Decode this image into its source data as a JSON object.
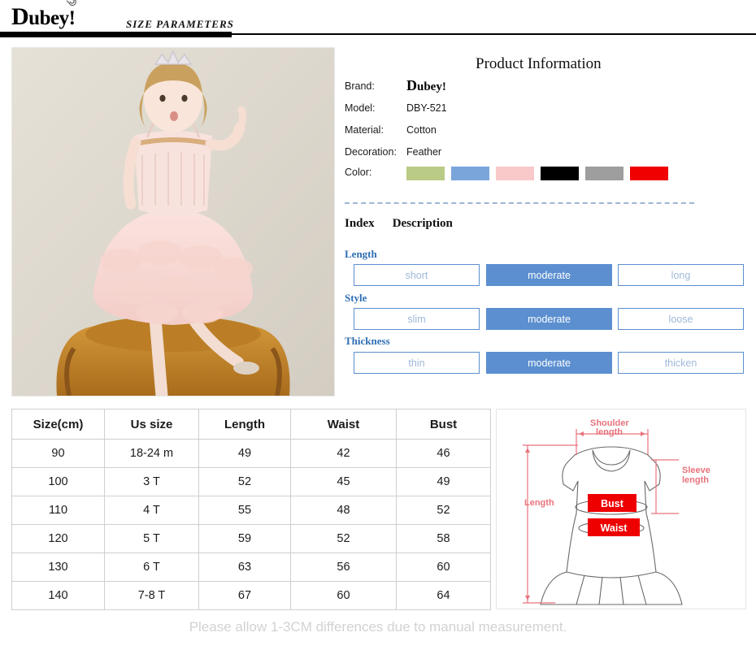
{
  "header": {
    "logo_text": "Dubey",
    "logo_initial": "D",
    "logo_rest": "ubey",
    "logo_mark": "spiral-exclamation",
    "title": "SIZE  PARAMETERS"
  },
  "photo": {
    "alt": "Girl wearing pink feather tutu dress with tiara sitting on mustard velvet armchair",
    "background_color": "#ddd8cf",
    "dress_color": "#f6d9d5",
    "chair_color": "#c98a2e",
    "hair_color": "#c9a05e"
  },
  "product_information": {
    "heading": "Product  Information",
    "rows": [
      {
        "label": "Brand:",
        "value": "Dubey",
        "is_logo": true
      },
      {
        "label": "Model:",
        "value": "DBY-521",
        "is_logo": false
      },
      {
        "label": "Material:",
        "value": "Cotton",
        "is_logo": false
      },
      {
        "label": "Decoration:",
        "value": "Feather",
        "is_logo": false
      }
    ],
    "color_label": "Color:",
    "colors": [
      {
        "name": "light-green",
        "hex": "#b9cb84"
      },
      {
        "name": "blue",
        "hex": "#7aa5da"
      },
      {
        "name": "pink",
        "hex": "#f9c9c9"
      },
      {
        "name": "black",
        "hex": "#000000"
      },
      {
        "name": "gray",
        "hex": "#9e9e9e"
      },
      {
        "name": "red",
        "hex": "#f10000"
      }
    ]
  },
  "index_section": {
    "heading_index": "Index",
    "heading_description": "Description",
    "accent_color": "#5b8fd0",
    "label_color": "#2e6eb5",
    "groups": [
      {
        "name": "Length",
        "options": [
          {
            "label": "short",
            "selected": false
          },
          {
            "label": "moderate",
            "selected": true
          },
          {
            "label": "long",
            "selected": false
          }
        ]
      },
      {
        "name": "Style",
        "options": [
          {
            "label": "slim",
            "selected": false
          },
          {
            "label": "moderate",
            "selected": true
          },
          {
            "label": "loose",
            "selected": false
          }
        ]
      },
      {
        "name": "Thickness",
        "options": [
          {
            "label": "thin",
            "selected": false
          },
          {
            "label": "moderate",
            "selected": true
          },
          {
            "label": "thicken",
            "selected": false
          }
        ]
      }
    ]
  },
  "size_table": {
    "columns": [
      "Size(cm)",
      "Us size",
      "Length",
      "Waist",
      "Bust"
    ],
    "rows": [
      [
        "90",
        "18-24 m",
        "49",
        "42",
        "46"
      ],
      [
        "100",
        "3 T",
        "52",
        "45",
        "49"
      ],
      [
        "110",
        "4 T",
        "55",
        "48",
        "52"
      ],
      [
        "120",
        "5 T",
        "59",
        "52",
        "58"
      ],
      [
        "130",
        "6 T",
        "63",
        "56",
        "60"
      ],
      [
        "140",
        "7-8 T",
        "67",
        "60",
        "64"
      ]
    ]
  },
  "measurement_diagram": {
    "labels": {
      "shoulder_line1": "Shoulder",
      "shoulder_line2": "length",
      "sleeve_line1": "Sleeve",
      "sleeve_line2": "length",
      "length": "Length",
      "bust": "Bust",
      "waist": "Waist"
    },
    "annotation_color": "#e8737d",
    "badge_color": "#ef0000"
  },
  "footer": {
    "note": "Please allow 1-3CM differences due to manual measurement."
  }
}
